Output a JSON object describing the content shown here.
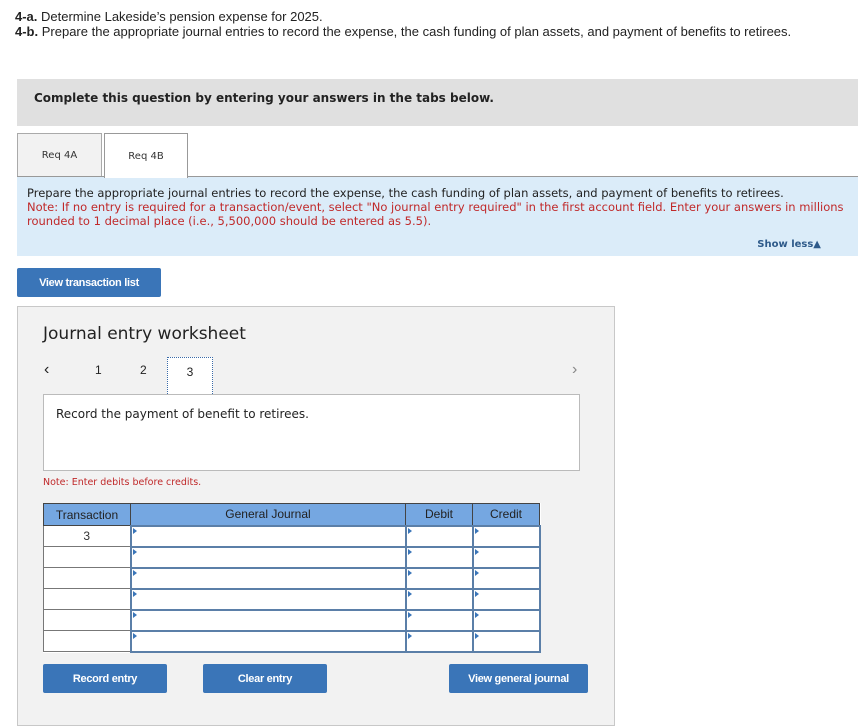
{
  "intro": {
    "line1_label": "4-a.",
    "line1_text": " Determine Lakeside’s pension expense for 2025.",
    "line2_label": "4-b.",
    "line2_text": " Prepare the appropriate journal entries to record the expense, the cash funding of plan assets, and payment of benefits to retirees."
  },
  "banner": {
    "text": "Complete this question by entering your answers in the tabs below."
  },
  "tabs": [
    {
      "label": "Req 4A",
      "active": false
    },
    {
      "label": "Req 4B",
      "active": true
    }
  ],
  "instructions": {
    "main": "Prepare the appropriate journal entries to record the expense, the cash funding of plan assets, and payment of benefits to retirees.",
    "note": "Note: If no entry is required for a transaction/event, select \"No journal entry required\" in the first account field. Enter your answers in millions rounded to 1 decimal place (i.e., 5,500,000 should be entered as 5.5).",
    "show_less": "Show less▲"
  },
  "buttons": {
    "view_transaction_list": "View transaction list",
    "record_entry": "Record entry",
    "clear_entry": "Clear entry",
    "view_general_journal": "View general journal"
  },
  "worksheet": {
    "title": "Journal entry worksheet",
    "prev_icon": "‹",
    "next_icon": "›",
    "pages": [
      "1",
      "2",
      "3"
    ],
    "current_page": "3",
    "description": "Record the payment of benefit to retirees.",
    "debits_note": "Note: Enter debits before credits."
  },
  "journal_table": {
    "headers": {
      "transaction": "Transaction",
      "general_journal": "General Journal",
      "debit": "Debit",
      "credit": "Credit"
    },
    "rows": [
      {
        "transaction": "3",
        "account": "",
        "debit": "",
        "credit": ""
      },
      {
        "transaction": "",
        "account": "",
        "debit": "",
        "credit": ""
      },
      {
        "transaction": "",
        "account": "",
        "debit": "",
        "credit": ""
      },
      {
        "transaction": "",
        "account": "",
        "debit": "",
        "credit": ""
      },
      {
        "transaction": "",
        "account": "",
        "debit": "",
        "credit": ""
      },
      {
        "transaction": "",
        "account": "",
        "debit": "",
        "credit": ""
      }
    ]
  },
  "colors": {
    "button_blue": "#3a75b8",
    "header_blue": "#75a7e1",
    "note_red": "#c0292a",
    "instructions_bg": "#dbecf9"
  }
}
